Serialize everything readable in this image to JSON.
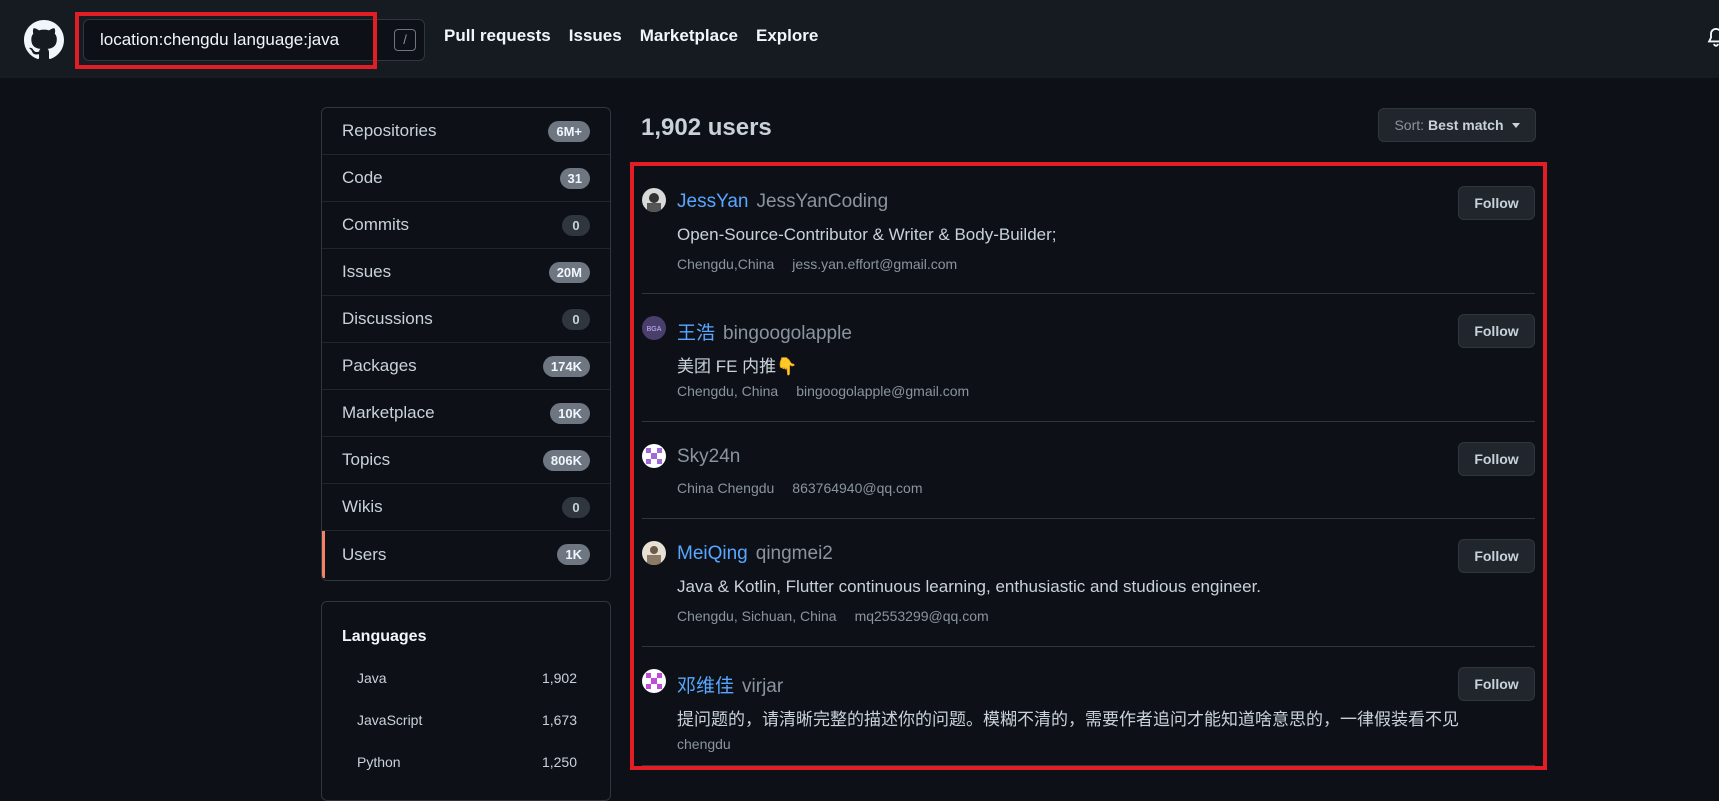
{
  "header": {
    "search_value": "location:chengdu language:java",
    "slash_hint": "/",
    "nav": [
      "Pull requests",
      "Issues",
      "Marketplace",
      "Explore"
    ]
  },
  "sidebar": {
    "filters": [
      {
        "label": "Repositories",
        "count": "6M+"
      },
      {
        "label": "Code",
        "count": "31"
      },
      {
        "label": "Commits",
        "count": "0"
      },
      {
        "label": "Issues",
        "count": "20M"
      },
      {
        "label": "Discussions",
        "count": "0"
      },
      {
        "label": "Packages",
        "count": "174K"
      },
      {
        "label": "Marketplace",
        "count": "10K"
      },
      {
        "label": "Topics",
        "count": "806K"
      },
      {
        "label": "Wikis",
        "count": "0"
      },
      {
        "label": "Users",
        "count": "1K"
      }
    ],
    "languages_title": "Languages",
    "languages": [
      {
        "name": "Java",
        "count": "1,902"
      },
      {
        "name": "JavaScript",
        "count": "1,673"
      },
      {
        "name": "Python",
        "count": "1,250"
      }
    ]
  },
  "main": {
    "result_count": "1,902 users",
    "sort_prefix": "Sort:",
    "sort_value": "Best match",
    "follow_label": "Follow",
    "users": [
      {
        "name": "JessYan",
        "login": "JessYanCoding",
        "bio": "Open-Source-Contributor & Writer & Body-Builder;",
        "location": "Chengdu,China",
        "email": "jess.yan.effort@gmail.com"
      },
      {
        "name": "王浩",
        "login": "bingoogolapple",
        "bio": "美团 FE 内推👇",
        "location": "Chengdu, China",
        "email": "bingoogolapple@gmail.com"
      },
      {
        "name": "",
        "login": "Sky24n",
        "bio": "",
        "location": "China Chengdu",
        "email": "863764940@qq.com"
      },
      {
        "name": "MeiQing",
        "login": "qingmei2",
        "bio": "Java & Kotlin, Flutter continuous learning, enthusiastic and studious engineer.",
        "location": "Chengdu, Sichuan, China",
        "email": "mq2553299@qq.com"
      },
      {
        "name": "邓维佳",
        "login": "virjar",
        "bio": "提问题的，请清晰完整的描述你的问题。模糊不清的，需要作者追问才能知道啥意思的，一律假装看不见",
        "location": "chengdu",
        "email": ""
      }
    ]
  },
  "colors": {
    "accent_link": "#58a6ff",
    "selected_marker": "#f78166",
    "highlight_box": "#e11d26"
  }
}
